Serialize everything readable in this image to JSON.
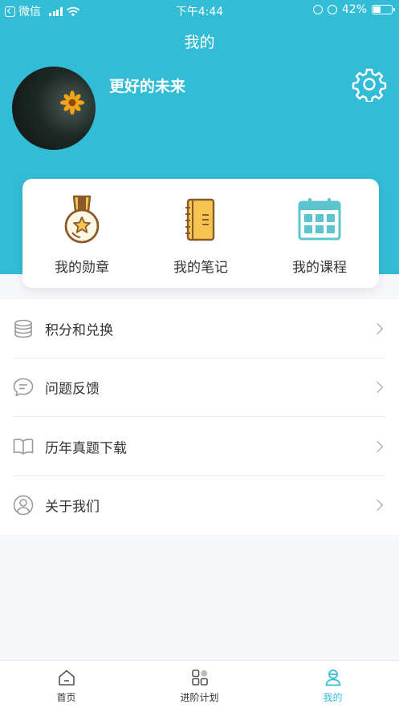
{
  "status_bar": {
    "carrier": "微信",
    "time": "下午4:44",
    "battery": "42%"
  },
  "header": {
    "title": "我的",
    "username": "更好的未来"
  },
  "colors": {
    "accent": "#33bcd5",
    "medal": "#8b5a2b",
    "note": "#f5c451",
    "calendar": "#5bc4cc"
  },
  "quick_links": [
    {
      "label": "我的勋章",
      "icon": "medal-icon"
    },
    {
      "label": "我的笔记",
      "icon": "notebook-icon"
    },
    {
      "label": "我的课程",
      "icon": "calendar-icon"
    }
  ],
  "menu": [
    {
      "label": "积分和兑换",
      "icon": "coins-icon"
    },
    {
      "label": "问题反馈",
      "icon": "chat-bubble-icon"
    },
    {
      "label": "历年真题下载",
      "icon": "open-book-icon"
    },
    {
      "label": "关于我们",
      "icon": "user-circle-icon"
    }
  ],
  "tabs": [
    {
      "label": "首页",
      "icon": "home-icon",
      "active": false
    },
    {
      "label": "进阶计划",
      "icon": "grid-icon",
      "active": false
    },
    {
      "label": "我的",
      "icon": "profile-icon",
      "active": true
    }
  ]
}
